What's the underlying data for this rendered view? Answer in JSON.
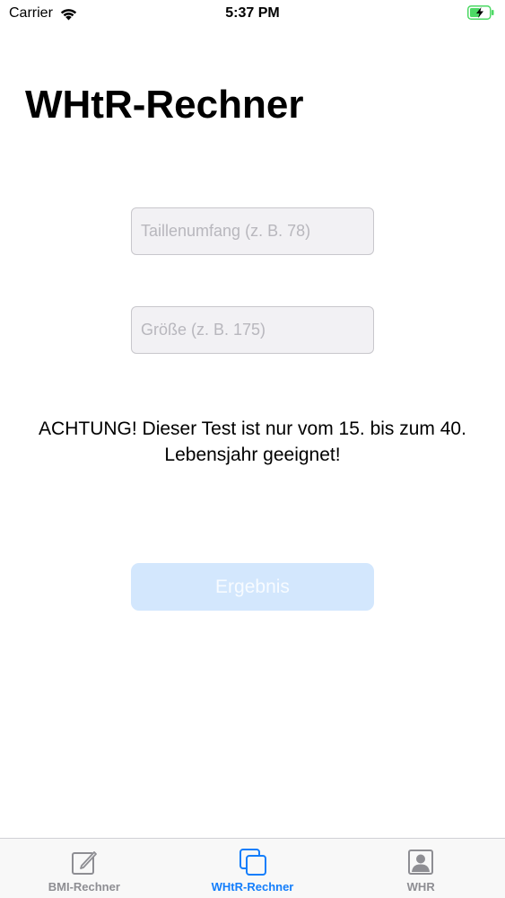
{
  "status_bar": {
    "carrier": "Carrier",
    "time": "5:37 PM"
  },
  "title": "WHtR-Rechner",
  "form": {
    "waist_placeholder": "Taillenumfang (z. B. 78)",
    "height_placeholder": "Größe (z. B. 175)",
    "waist_value": "",
    "height_value": ""
  },
  "warning": "ACHTUNG! Dieser Test ist nur vom 15. bis zum 40. Lebensjahr geeignet!",
  "result_button": "Ergebnis",
  "tabs": [
    {
      "label": "BMI-Rechner",
      "icon": "compose-icon",
      "active": false
    },
    {
      "label": "WHtR-Rechner",
      "icon": "stacked-squares-icon",
      "active": true
    },
    {
      "label": "WHR",
      "icon": "person-portrait-icon",
      "active": false
    }
  ],
  "colors": {
    "accent": "#147efb",
    "inactive": "#8e8e93",
    "button_disabled_bg": "#d3e7fd",
    "battery_green": "#4cd964"
  }
}
